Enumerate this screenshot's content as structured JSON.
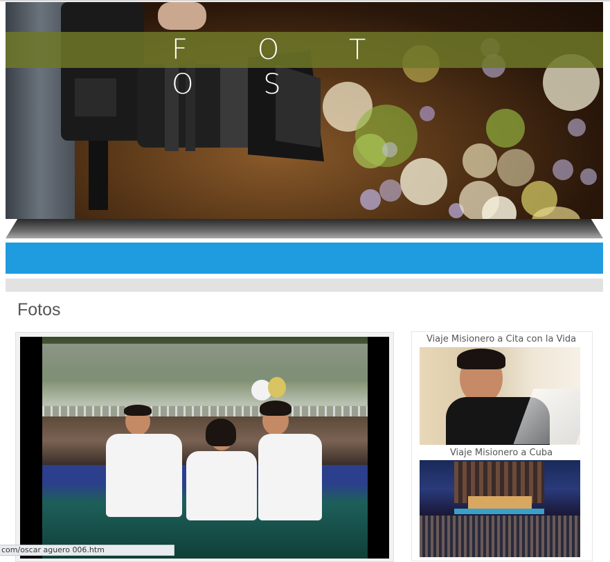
{
  "banner": {
    "title": "F O T O S"
  },
  "page": {
    "title": "Fotos"
  },
  "sidebar": {
    "items": [
      {
        "caption": "Viaje Misionero a Cita con la Vida"
      },
      {
        "caption": "Viaje Misionero a Cuba"
      }
    ]
  },
  "status_bar": {
    "url": "com/oscar aguero 006.htm"
  },
  "colors": {
    "accent_bar": "#1f9be0",
    "banner_overlay": "#6e7828",
    "grey_bar": "#e2e2e2"
  }
}
